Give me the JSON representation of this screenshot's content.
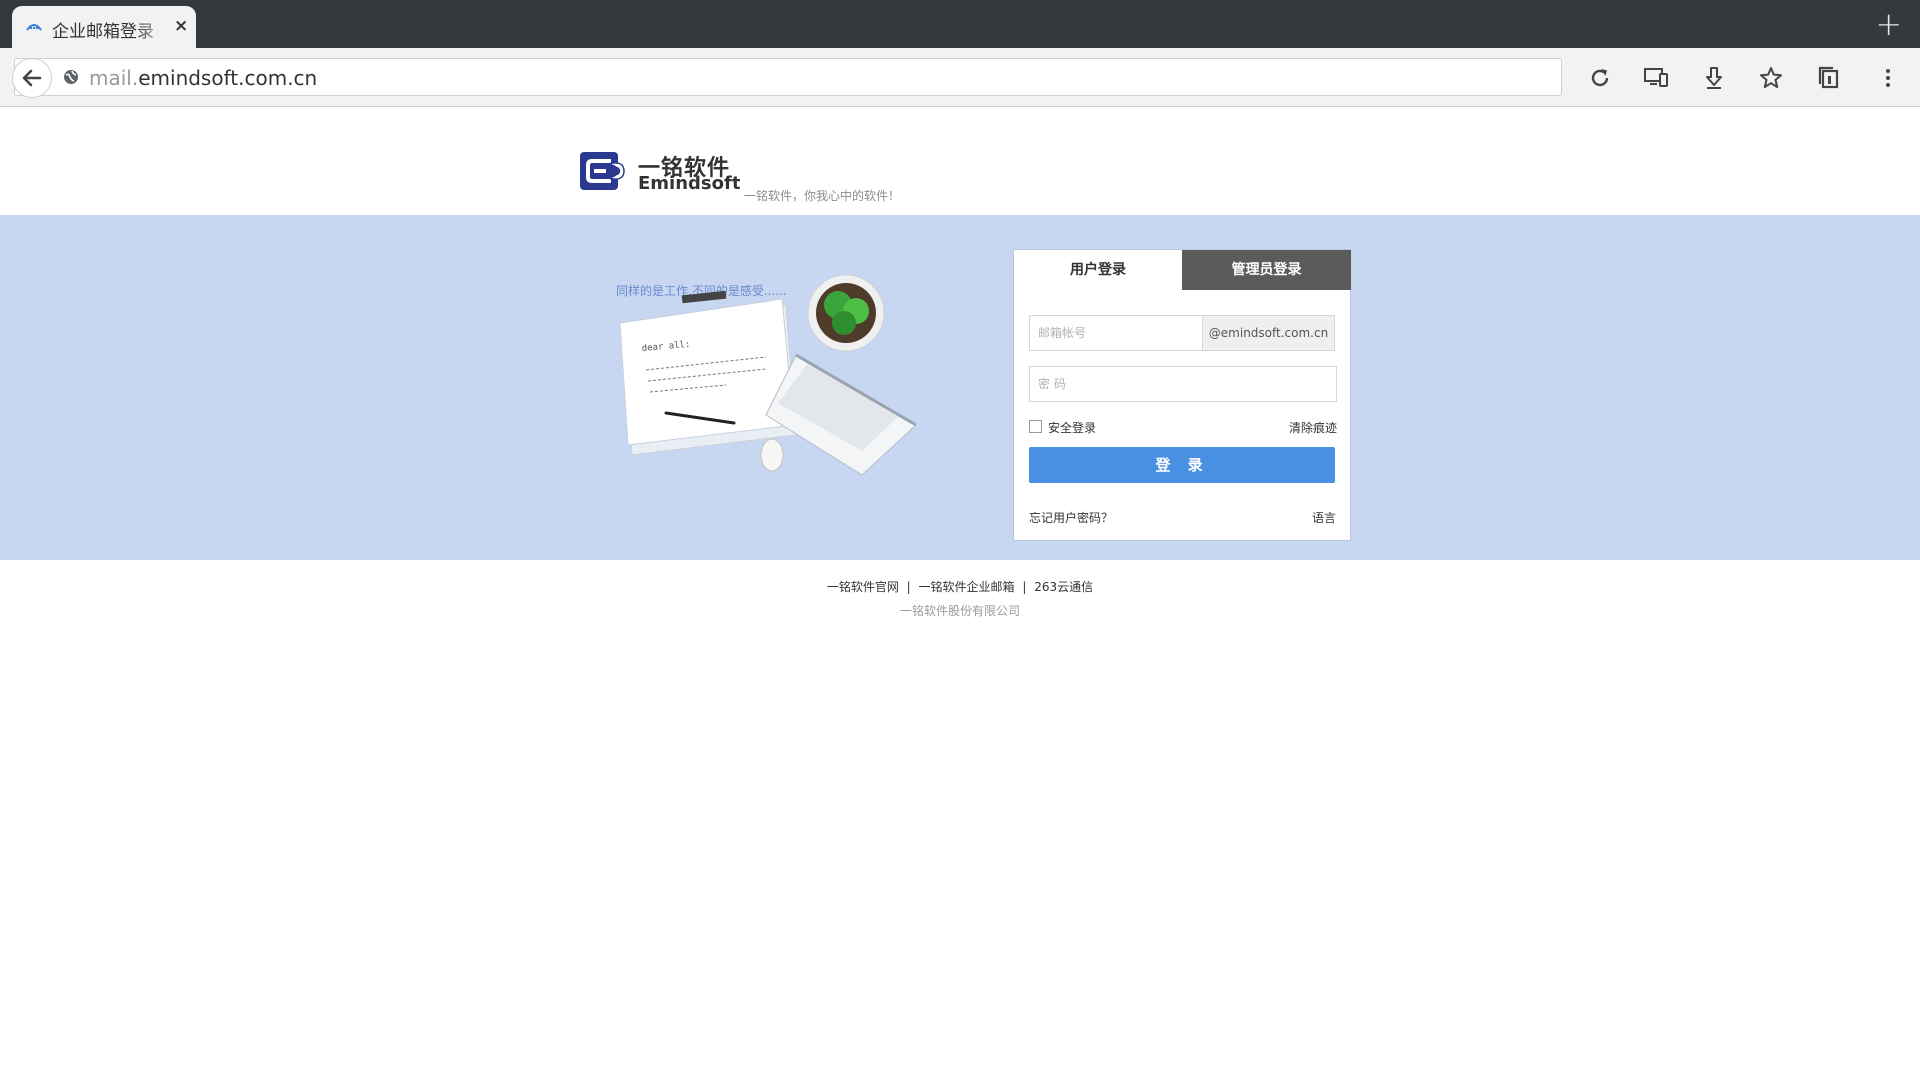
{
  "browser": {
    "tab_title": "企业邮箱登录",
    "tab_close": "×",
    "new_tab": "+",
    "url_subdomain": "mail.",
    "url_domain": "emindsoft.com.cn"
  },
  "header": {
    "logo_cn": "一铭软件",
    "logo_en": "Emindsoft",
    "slogan": "一铭软件，你我心中的软件！"
  },
  "banner": {
    "caption": "同样的是工作,不同的是感受......",
    "note_greeting": "dear all:"
  },
  "login": {
    "tab_user": "用户登录",
    "tab_admin": "管理员登录",
    "email_placeholder": "邮箱帐号",
    "domain_suffix": "@emindsoft.com.cn",
    "password_placeholder": "密 码",
    "secure_login": "安全登录",
    "clear_trace": "清除痕迹",
    "submit": "登 录",
    "forgot": "忘记用户密码？",
    "language": "语言"
  },
  "footer": {
    "link_official": "一铭软件官网",
    "sep1": "|",
    "link_mail": "一铭软件企业邮箱",
    "sep2": "|",
    "link_263": "263云通信",
    "copyright": "一铭软件股份有限公司"
  },
  "colors": {
    "banner_bg": "#c7d7f2",
    "login_button": "#4a90e2",
    "admin_tab": "#5b5b5b",
    "tabbar": "#35383c"
  }
}
